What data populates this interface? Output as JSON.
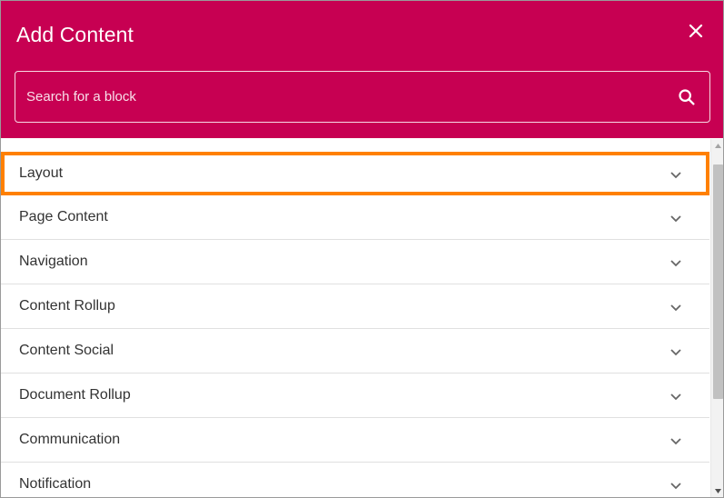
{
  "dialog": {
    "title": "Add Content",
    "close_icon": "close-icon"
  },
  "search": {
    "placeholder": "Search for a block",
    "value": "",
    "icon": "search-icon"
  },
  "categories": [
    {
      "label": "Layout",
      "highlighted": true,
      "icon": "chevron-down-icon"
    },
    {
      "label": "Page Content",
      "icon": "chevron-down-icon"
    },
    {
      "label": "Navigation",
      "icon": "chevron-down-icon"
    },
    {
      "label": "Content Rollup",
      "icon": "chevron-down-icon"
    },
    {
      "label": "Content Social",
      "icon": "chevron-down-icon"
    },
    {
      "label": "Document Rollup",
      "icon": "chevron-down-icon"
    },
    {
      "label": "Communication",
      "icon": "chevron-down-icon"
    },
    {
      "label": "Notification",
      "icon": "chevron-down-icon"
    }
  ],
  "colors": {
    "header_bg": "#c70052",
    "highlight_border": "#ff8000",
    "text": "#333333"
  }
}
